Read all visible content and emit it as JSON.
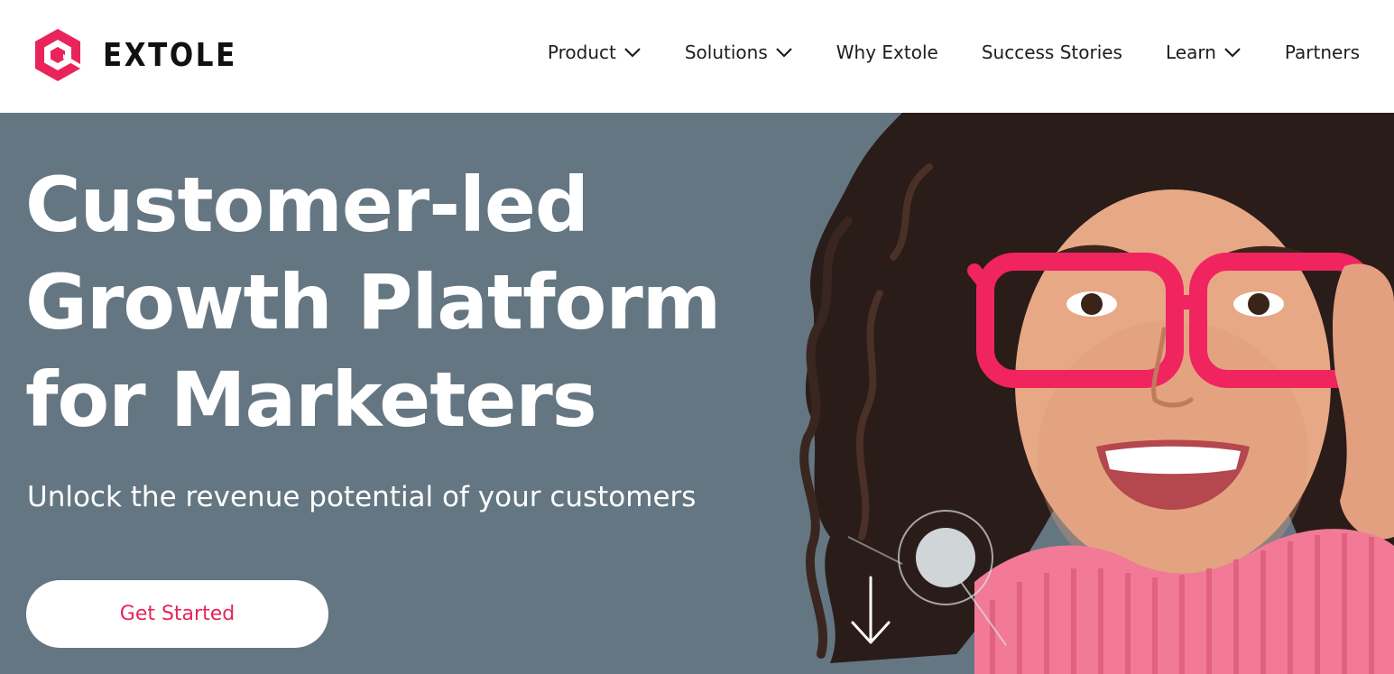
{
  "brand": {
    "name": "EXTOLE",
    "logo_icon": "extole-hexagon-logo-icon",
    "accent_color": "#e8245a"
  },
  "nav": {
    "items": [
      {
        "label": "Product",
        "dropdown": true
      },
      {
        "label": "Solutions",
        "dropdown": true
      },
      {
        "label": "Why Extole",
        "dropdown": false
      },
      {
        "label": "Success Stories",
        "dropdown": false
      },
      {
        "label": "Learn",
        "dropdown": true
      },
      {
        "label": "Partners",
        "dropdown": false
      }
    ]
  },
  "hero": {
    "title_lines": [
      "Customer-led",
      "Growth Platform",
      "for Marketers"
    ],
    "subtitle": "Unlock the revenue potential of your customers",
    "cta_label": "Get Started",
    "background_color": "#647682",
    "image_subject": "smiling woman with curly hair, pink glasses and pink knit sweater",
    "scroll_icon": "arrow-down-icon"
  }
}
